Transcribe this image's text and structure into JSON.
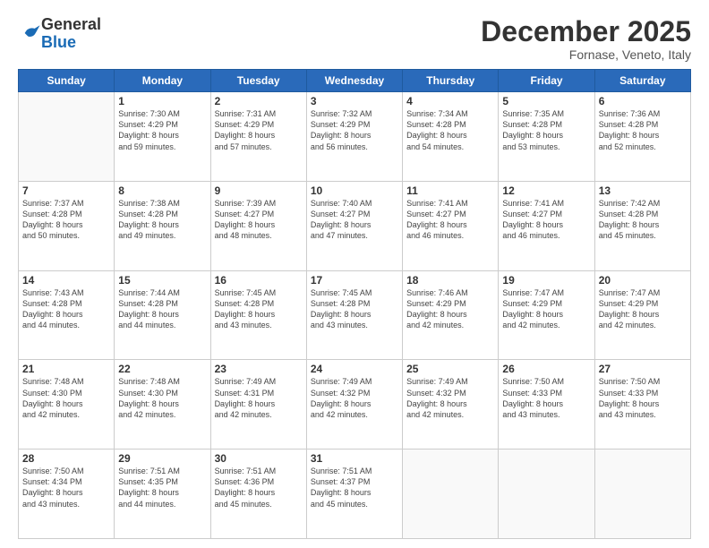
{
  "logo": {
    "general": "General",
    "blue": "Blue"
  },
  "title": "December 2025",
  "location": "Fornase, Veneto, Italy",
  "days": [
    "Sunday",
    "Monday",
    "Tuesday",
    "Wednesday",
    "Thursday",
    "Friday",
    "Saturday"
  ],
  "weeks": [
    [
      {
        "day": "",
        "info": ""
      },
      {
        "day": "1",
        "info": "Sunrise: 7:30 AM\nSunset: 4:29 PM\nDaylight: 8 hours\nand 59 minutes."
      },
      {
        "day": "2",
        "info": "Sunrise: 7:31 AM\nSunset: 4:29 PM\nDaylight: 8 hours\nand 57 minutes."
      },
      {
        "day": "3",
        "info": "Sunrise: 7:32 AM\nSunset: 4:29 PM\nDaylight: 8 hours\nand 56 minutes."
      },
      {
        "day": "4",
        "info": "Sunrise: 7:34 AM\nSunset: 4:28 PM\nDaylight: 8 hours\nand 54 minutes."
      },
      {
        "day": "5",
        "info": "Sunrise: 7:35 AM\nSunset: 4:28 PM\nDaylight: 8 hours\nand 53 minutes."
      },
      {
        "day": "6",
        "info": "Sunrise: 7:36 AM\nSunset: 4:28 PM\nDaylight: 8 hours\nand 52 minutes."
      }
    ],
    [
      {
        "day": "7",
        "info": "Sunrise: 7:37 AM\nSunset: 4:28 PM\nDaylight: 8 hours\nand 50 minutes."
      },
      {
        "day": "8",
        "info": "Sunrise: 7:38 AM\nSunset: 4:28 PM\nDaylight: 8 hours\nand 49 minutes."
      },
      {
        "day": "9",
        "info": "Sunrise: 7:39 AM\nSunset: 4:27 PM\nDaylight: 8 hours\nand 48 minutes."
      },
      {
        "day": "10",
        "info": "Sunrise: 7:40 AM\nSunset: 4:27 PM\nDaylight: 8 hours\nand 47 minutes."
      },
      {
        "day": "11",
        "info": "Sunrise: 7:41 AM\nSunset: 4:27 PM\nDaylight: 8 hours\nand 46 minutes."
      },
      {
        "day": "12",
        "info": "Sunrise: 7:41 AM\nSunset: 4:27 PM\nDaylight: 8 hours\nand 46 minutes."
      },
      {
        "day": "13",
        "info": "Sunrise: 7:42 AM\nSunset: 4:28 PM\nDaylight: 8 hours\nand 45 minutes."
      }
    ],
    [
      {
        "day": "14",
        "info": "Sunrise: 7:43 AM\nSunset: 4:28 PM\nDaylight: 8 hours\nand 44 minutes."
      },
      {
        "day": "15",
        "info": "Sunrise: 7:44 AM\nSunset: 4:28 PM\nDaylight: 8 hours\nand 44 minutes."
      },
      {
        "day": "16",
        "info": "Sunrise: 7:45 AM\nSunset: 4:28 PM\nDaylight: 8 hours\nand 43 minutes."
      },
      {
        "day": "17",
        "info": "Sunrise: 7:45 AM\nSunset: 4:28 PM\nDaylight: 8 hours\nand 43 minutes."
      },
      {
        "day": "18",
        "info": "Sunrise: 7:46 AM\nSunset: 4:29 PM\nDaylight: 8 hours\nand 42 minutes."
      },
      {
        "day": "19",
        "info": "Sunrise: 7:47 AM\nSunset: 4:29 PM\nDaylight: 8 hours\nand 42 minutes."
      },
      {
        "day": "20",
        "info": "Sunrise: 7:47 AM\nSunset: 4:29 PM\nDaylight: 8 hours\nand 42 minutes."
      }
    ],
    [
      {
        "day": "21",
        "info": "Sunrise: 7:48 AM\nSunset: 4:30 PM\nDaylight: 8 hours\nand 42 minutes."
      },
      {
        "day": "22",
        "info": "Sunrise: 7:48 AM\nSunset: 4:30 PM\nDaylight: 8 hours\nand 42 minutes."
      },
      {
        "day": "23",
        "info": "Sunrise: 7:49 AM\nSunset: 4:31 PM\nDaylight: 8 hours\nand 42 minutes."
      },
      {
        "day": "24",
        "info": "Sunrise: 7:49 AM\nSunset: 4:32 PM\nDaylight: 8 hours\nand 42 minutes."
      },
      {
        "day": "25",
        "info": "Sunrise: 7:49 AM\nSunset: 4:32 PM\nDaylight: 8 hours\nand 42 minutes."
      },
      {
        "day": "26",
        "info": "Sunrise: 7:50 AM\nSunset: 4:33 PM\nDaylight: 8 hours\nand 43 minutes."
      },
      {
        "day": "27",
        "info": "Sunrise: 7:50 AM\nSunset: 4:33 PM\nDaylight: 8 hours\nand 43 minutes."
      }
    ],
    [
      {
        "day": "28",
        "info": "Sunrise: 7:50 AM\nSunset: 4:34 PM\nDaylight: 8 hours\nand 43 minutes."
      },
      {
        "day": "29",
        "info": "Sunrise: 7:51 AM\nSunset: 4:35 PM\nDaylight: 8 hours\nand 44 minutes."
      },
      {
        "day": "30",
        "info": "Sunrise: 7:51 AM\nSunset: 4:36 PM\nDaylight: 8 hours\nand 45 minutes."
      },
      {
        "day": "31",
        "info": "Sunrise: 7:51 AM\nSunset: 4:37 PM\nDaylight: 8 hours\nand 45 minutes."
      },
      {
        "day": "",
        "info": ""
      },
      {
        "day": "",
        "info": ""
      },
      {
        "day": "",
        "info": ""
      }
    ]
  ]
}
